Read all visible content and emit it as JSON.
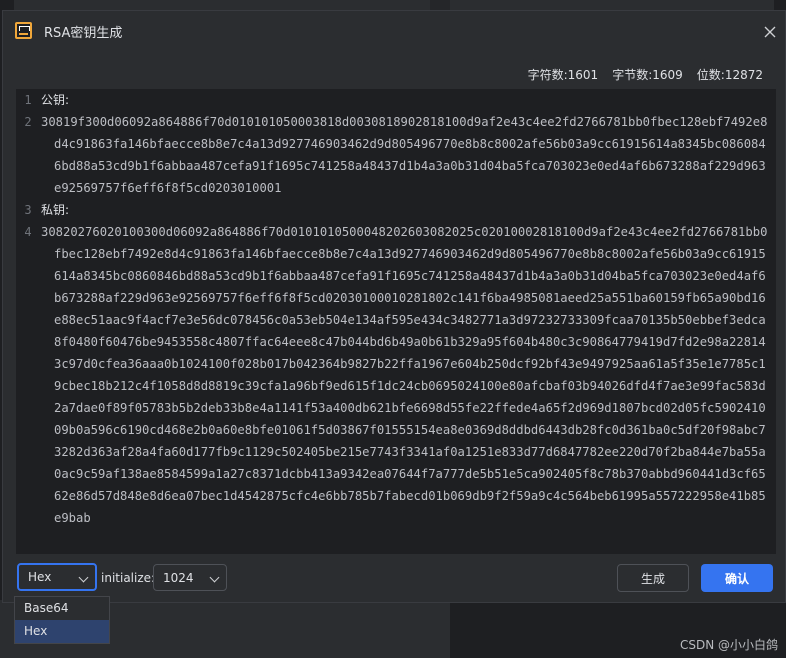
{
  "dialog": {
    "title": "RSA密钥生成",
    "close_icon": "×"
  },
  "stats": {
    "char_count": "字符数:1601",
    "byte_count": "字节数:1609",
    "bit_count": "位数:12872"
  },
  "editor": {
    "lines": [
      {
        "num": "1",
        "text": "公钥:"
      },
      {
        "num": "2",
        "text": "30819f300d06092a864886f70d010101050003818d0030818902818100d9af2e43c4ee2fd2766781bb0fbec128ebf7492e8d4c91863fa146bfaecce8b8e7c4a13d927746903462d9d805496770e8b8c8002afe56b03a9cc61915614a8345bc0860846bd88a53cd9b1f6abbaa487cefa91f1695c741258a48437d1b4a3a0b31d04ba5fca703023e0ed4af6b673288af229d963e92569757f6eff6f8f5cd0203010001"
      },
      {
        "num": "3",
        "text": "私钥:"
      },
      {
        "num": "4",
        "text": "30820276020100300d06092a864886f70d0101010500048202603082025c02010002818100d9af2e43c4ee2fd2766781bb0fbec128ebf7492e8d4c91863fa146bfaecce8b8e7c4a13d927746903462d9d805496770e8b8c8002afe56b03a9cc61915614a8345bc0860846bd88a53cd9b1f6abbaa487cefa91f1695c741258a48437d1b4a3a0b31d04ba5fca703023e0ed4af6b673288af229d963e92569757f6eff6f8f5cd02030100010281802c141f6ba4985081aeed25a551ba60159fb65a90bd16e88ec51aac9f4acf7e3e56dc078456c0a53eb504e134af595e434c3482771a3d97232733309fcaa70135b50ebbef3edca8f0480f60476be9453558c4807ffac64eee8c47b044bd6b49a0b61b329a95f604b480c3c90864779419d7fd2e98a228143c97d0cfea36aaa0b1024100f028b017b042364b9827b22ffa1967e604b250dcf92bf43e9497925aa61a5f35e1e7785c19cbec18b212c4f1058d8d8819c39cfa1a96bf9ed615f1dc24cb0695024100e80afcbaf03b94026dfd4f7ae3e99fac583d2a7dae0f89f05783b5b2deb33b8e4a1141f53a400db621bfe6698d55fe22ffede4a65f2d969d1807bcd02d05fc590241009b0a596c6190cd468e2b0a60e8bfe01061f5d03867f01555154ea8e0369d8ddbd6443db28fc0d361ba0c5df20f98abc73282d363af28a4fa60d177fb9c1129c502405be215e7743f3341af0a1251e833d77d6847782ee220d70f2ba844e7ba55a0ac9c59af138ae8584599a1a27c8371dcbb413a9342ea07644f7a777de5b51e5ca902405f8c78b370abbd960441d3cf6562e86d57d848e8d6ea07bec1d4542875cfc4e6bb785b7fabecd01b069db9f2f59a9c4c564beb61995a557222958e41b85e9bab"
      }
    ]
  },
  "bottom": {
    "format_value": "Hex",
    "initialize_label": "initialize:",
    "size_value": "1024",
    "generate_label": "生成",
    "confirm_label": "确认"
  },
  "dropdown": {
    "options": [
      "Base64",
      "Hex"
    ],
    "selected": "Hex"
  },
  "watermark": "CSDN @小小白鸽",
  "colors": {
    "accent": "#3574f0",
    "background": "#2b2d30",
    "editor_bg": "#1e1f22"
  }
}
